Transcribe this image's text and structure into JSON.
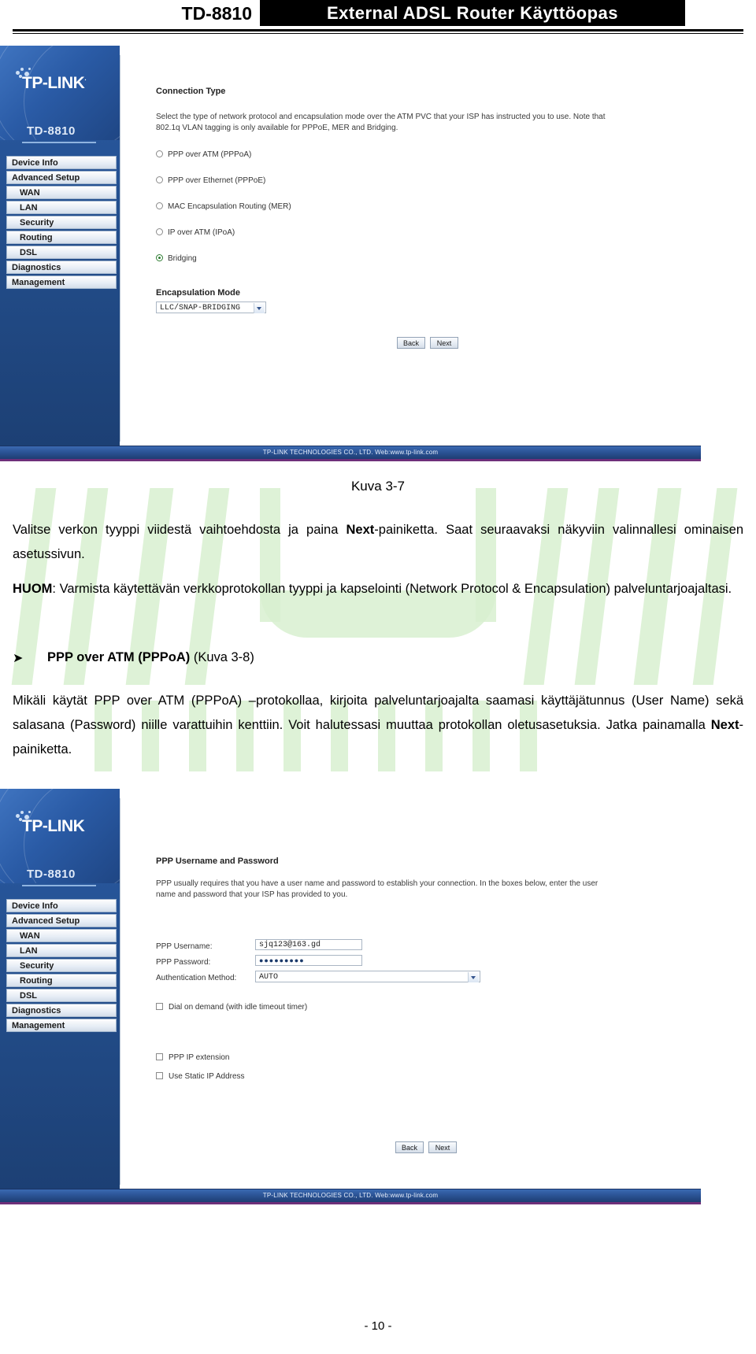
{
  "header": {
    "model": "TD-8810",
    "title": "External  ADSL  Router  Käyttöopas"
  },
  "screenshot1": {
    "brand": "TP-LINK",
    "trademark": "·",
    "model": "TD-8810",
    "menu": [
      {
        "label": "Device Info",
        "sub": false
      },
      {
        "label": "Advanced Setup",
        "sub": false
      },
      {
        "label": "WAN",
        "sub": true
      },
      {
        "label": "LAN",
        "sub": true
      },
      {
        "label": "Security",
        "sub": true
      },
      {
        "label": "Routing",
        "sub": true
      },
      {
        "label": "DSL",
        "sub": true
      },
      {
        "label": "Diagnostics",
        "sub": false
      },
      {
        "label": "Management",
        "sub": false
      }
    ],
    "section_title": "Connection Type",
    "desc_line1": "Select the type of network protocol and encapsulation mode over the ATM PVC that your ISP has instructed you to use. Note that",
    "desc_line2": "802.1q VLAN tagging is only available for PPPoE, MER and Bridging.",
    "options": [
      {
        "label": "PPP over ATM (PPPoA)",
        "selected": false
      },
      {
        "label": "PPP over Ethernet (PPPoE)",
        "selected": false
      },
      {
        "label": "MAC Encapsulation Routing (MER)",
        "selected": false
      },
      {
        "label": "IP over ATM (IPoA)",
        "selected": false
      },
      {
        "label": "Bridging",
        "selected": true
      }
    ],
    "encapsulation_label": "Encapsulation Mode",
    "encapsulation_value": "LLC/SNAP-BRIDGING",
    "back_label": "Back",
    "next_label": "Next",
    "footer": "TP-LINK TECHNOLOGIES CO., LTD. Web:www.tp-link.com"
  },
  "screenshot2": {
    "brand": "TP-LINK",
    "model": "TD-8810",
    "menu": [
      {
        "label": "Device Info",
        "sub": false
      },
      {
        "label": "Advanced Setup",
        "sub": false
      },
      {
        "label": "WAN",
        "sub": true
      },
      {
        "label": "LAN",
        "sub": true
      },
      {
        "label": "Security",
        "sub": true
      },
      {
        "label": "Routing",
        "sub": true
      },
      {
        "label": "DSL",
        "sub": true
      },
      {
        "label": "Diagnostics",
        "sub": false
      },
      {
        "label": "Management",
        "sub": false
      }
    ],
    "section_title": "PPP Username and Password",
    "desc_line1": "PPP usually requires that you have a user name and password to establish your connection. In the boxes below, enter the user",
    "desc_line2": "name and password that your ISP has provided to you.",
    "fields": [
      {
        "label": "PPP Username:",
        "value": "sjq123@163.gd"
      },
      {
        "label": "PPP Password:",
        "value": "●●●●●●●●●"
      },
      {
        "label": "Authentication Method:",
        "value": "AUTO"
      }
    ],
    "checkboxes": [
      {
        "label": "Dial on demand (with idle timeout timer)",
        "checked": false
      },
      {
        "label": "PPP IP extension",
        "checked": false
      },
      {
        "label": "Use Static IP Address",
        "checked": false
      }
    ],
    "back_label": "Back",
    "next_label": "Next",
    "footer": "TP-LINK TECHNOLOGIES CO., LTD. Web:www.tp-link.com"
  },
  "body": {
    "caption_1": "Kuva 3-7",
    "para1_a": "Valitse verkon tyyppi viidestä vaihtoehdosta ja paina ",
    "para1_b": "Next",
    "para1_c": "-painiketta. Saat seuraavaksi näkyviin valinnallesi ominaisen asetussivun.",
    "para2_a": "HUOM",
    "para2_b": ": Varmista käytettävän verkkoprotokollan tyyppi ja kapselointi (Network Protocol & Encapsulation) palveluntarjoajaltasi.",
    "bullet_mark": "➤",
    "bullet_bold": "PPP over ATM (PPPoA)",
    "bullet_rest": " (Kuva 3-8)",
    "para3_a": "Mikäli käytät PPP over ATM (PPPoA) –protokollaa, kirjoita palveluntarjoajalta saamasi käyttäjätunnus (User Name) sekä salasana (Password) niille varattuihin kenttiin. Voit halutessasi muuttaa protokollan oletusasetuksia. Jatka painamalla ",
    "para3_b": "Next",
    "para3_c": "-painiketta."
  },
  "page_number": "- 10 -",
  "colors": {
    "brand_blue": "#2a5293",
    "header_black": "#000000",
    "watermark_green": "#d8f0d0",
    "radio_selected": "#2e7d32"
  }
}
